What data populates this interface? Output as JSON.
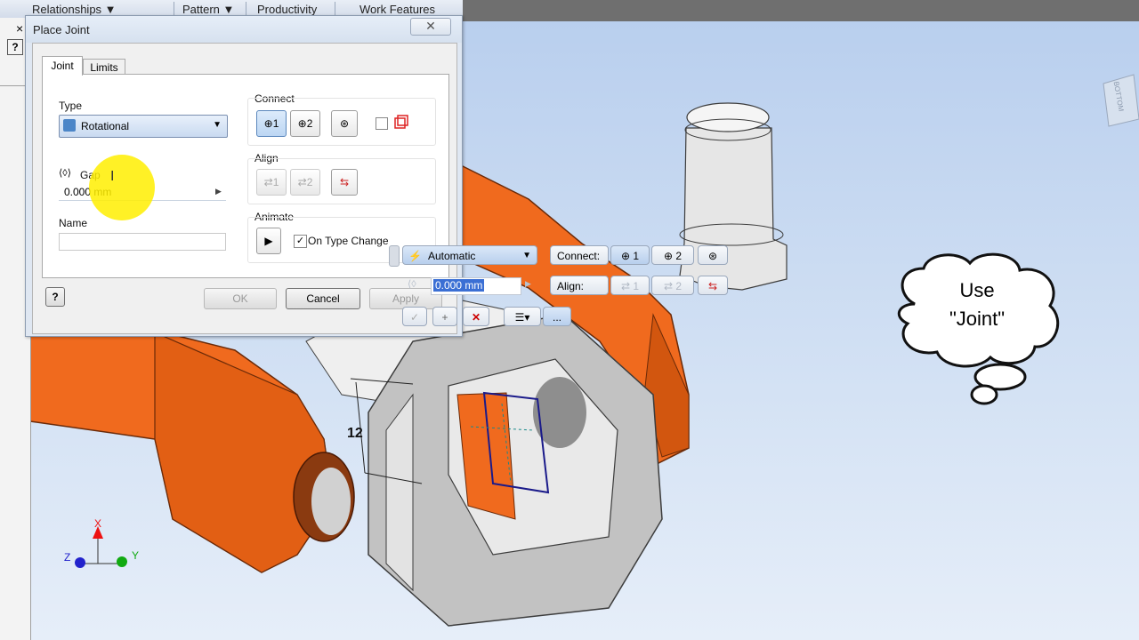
{
  "ribbon": {
    "items": [
      "Relationships ▼",
      "Pattern ▼",
      "Productivity",
      "Work Features"
    ]
  },
  "left_strip": {
    "close": "×"
  },
  "dialog": {
    "title": "Place Joint",
    "close_label": "✕",
    "tabs": [
      "Joint",
      "Limits"
    ],
    "type_label": "Type",
    "type_value": "Rotational",
    "gap_label": "Gap",
    "gap_value": "0.000 mm",
    "name_label": "Name",
    "name_value": "",
    "connect_label": "Connect",
    "connect_btn1": "1",
    "connect_btn2": "2",
    "align_label": "Align",
    "align_btn1": "1",
    "align_btn2": "2",
    "animate_label": "Animate",
    "on_type_change_label": "On Type Change",
    "on_type_change_checked": true,
    "help": "?",
    "ok_label": "OK",
    "cancel_label": "Cancel",
    "apply_label": "Apply"
  },
  "mini_toolbar": {
    "type_value": "Automatic",
    "connect_label": "Connect:",
    "connect_btn1": "1",
    "connect_btn2": "2",
    "align_label": "Align:",
    "align_btn1": "1",
    "align_btn2": "2",
    "gap_value": "0.000 mm",
    "ok_glyph": "✓",
    "apply_glyph": "+",
    "cancel_glyph": "✕",
    "more_label": "..."
  },
  "viewport": {
    "dimension_label": "12",
    "viewcube_label": "BOTTOM",
    "axis_x": "X",
    "axis_y": "Y",
    "axis_z": "Z"
  },
  "callout": {
    "line1": "Use",
    "line2": "\"Joint\""
  },
  "colors": {
    "part_orange": "#f06a1e",
    "part_gray": "#cfcfcf",
    "highlight_yellow": "#ffee00",
    "selection_blue": "#1a1a8a"
  }
}
